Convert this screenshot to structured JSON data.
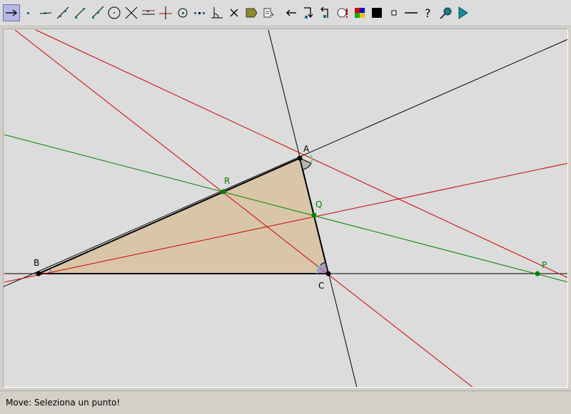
{
  "toolbar": {
    "tools": [
      {
        "name": "move-tool-button",
        "icon": "move-arrow-icon",
        "active": true
      },
      {
        "name": "new-point-button",
        "icon": "point-icon"
      },
      {
        "name": "point-on-object-button",
        "icon": "point-on-object-icon"
      },
      {
        "name": "line-through-two-points-button",
        "icon": "line-icon"
      },
      {
        "name": "segment-button",
        "icon": "segment-icon"
      },
      {
        "name": "ray-button",
        "icon": "ray-icon"
      },
      {
        "name": "circle-button",
        "icon": "circle-icon"
      },
      {
        "name": "intersect-button",
        "icon": "intersect-icon"
      },
      {
        "name": "parallel-line-button",
        "icon": "parallel-line-icon"
      },
      {
        "name": "perpendicular-line-button",
        "icon": "perpendicular-line-icon"
      },
      {
        "name": "center-button",
        "icon": "center-point-icon"
      },
      {
        "name": "dotted-line-button",
        "icon": "dotted-line-icon"
      },
      {
        "name": "angle-button",
        "icon": "angle-icon"
      },
      {
        "name": "delete-button",
        "icon": "delete-x-icon"
      },
      {
        "name": "macro-button",
        "icon": "macro-icon"
      },
      {
        "name": "text-button",
        "icon": "text-icon"
      },
      {
        "name": "undo-button",
        "icon": "undo-arrow-icon"
      },
      {
        "name": "hide-button",
        "icon": "hide-icon"
      },
      {
        "name": "show-button",
        "icon": "show-icon"
      },
      {
        "name": "comment-button",
        "icon": "comment-icon"
      },
      {
        "name": "color-button",
        "icon": "color-palette-icon"
      },
      {
        "name": "fill-button",
        "icon": "fill-square-icon"
      },
      {
        "name": "point-size-button",
        "icon": "small-square-icon"
      },
      {
        "name": "line-style-button",
        "icon": "line-style-icon"
      },
      {
        "name": "help-button",
        "icon": "question-icon"
      },
      {
        "name": "zoom-button",
        "icon": "magnifier-icon"
      },
      {
        "name": "run-button",
        "icon": "play-icon"
      }
    ]
  },
  "figure": {
    "points": [
      {
        "id": "A",
        "label": "A",
        "color": "#000000"
      },
      {
        "id": "B",
        "label": "B",
        "color": "#000000"
      },
      {
        "id": "C",
        "label": "C",
        "color": "#000000"
      },
      {
        "id": "P",
        "label": "P",
        "color": "#008000"
      },
      {
        "id": "Q",
        "label": "Q",
        "color": "#008000"
      },
      {
        "id": "R",
        "label": "R",
        "color": "#008000"
      }
    ],
    "colors": {
      "triangle_fill": "#d9c6a8",
      "black_line": "#000000",
      "red_line": "#cc0000",
      "green_line": "#008000",
      "angle_gray": "#9a9a9a",
      "angle_green": "#7cc78a",
      "angle_purple": "#9a86c8",
      "angle_blue": "#8cb8d8"
    }
  },
  "status": {
    "text": "Move: Seleziona un punto!"
  }
}
